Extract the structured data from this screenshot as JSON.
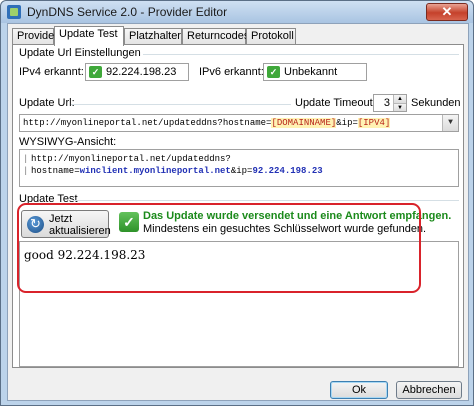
{
  "window": {
    "title": "DynDNS Service 2.0 - Provider Editor",
    "close_glyph": "✕"
  },
  "tabs": [
    "Provider",
    "Update Test",
    "Platzhalter",
    "Returncodes",
    "Protokoll"
  ],
  "detected": {
    "section_label": "Update Url Einstellungen",
    "ipv4_label": "IPv4 erkannt:",
    "ipv4_value": "92.224.198.23",
    "ipv6_label": "IPv6 erkannt:",
    "ipv6_value": "Unbekannt"
  },
  "update_url": {
    "label": "Update Url:",
    "prefix": "http://myonlineportal.net/updateddns?hostname=",
    "placeholder_domain": "[DOMAINNAME]",
    "middle": "&ip=",
    "placeholder_ip": "[IPV4]",
    "timeout_label": "Update Timeout:",
    "timeout_value": "3",
    "timeout_unit": "Sekunden"
  },
  "wysiwyg": {
    "label": "WYSIWYG-Ansicht:",
    "line1": "http://myonlineportal.net/updateddns?",
    "line2_prefix": "hostname=",
    "line2_host": "winclient.myonlineportal.net",
    "line2_mid": "&ip=",
    "line2_ip": "92.224.198.23"
  },
  "update_test": {
    "section_label": "Update Test",
    "refresh_line1": "Jetzt",
    "refresh_line2": "aktualisieren",
    "success_title": "Das Update wurde versendet und eine Antwort empfangen.",
    "success_sub": "Mindestens ein gesuchtes Schlüsselwort wurde gefunden.",
    "result_text": "good 92.224.198.23"
  },
  "buttons": {
    "ok": "Ok",
    "cancel": "Abbrechen"
  },
  "colors": {
    "accent_green": "#1b8a1b",
    "highlight_red": "#d9232b",
    "placeholder_red": "#b8261b",
    "value_blue": "#2231b5"
  },
  "icons": [
    "app-icon",
    "close-icon",
    "check-icon",
    "dropdown-arrow-icon",
    "spin-up-icon",
    "spin-down-icon",
    "refresh-icon",
    "success-check-icon"
  ]
}
